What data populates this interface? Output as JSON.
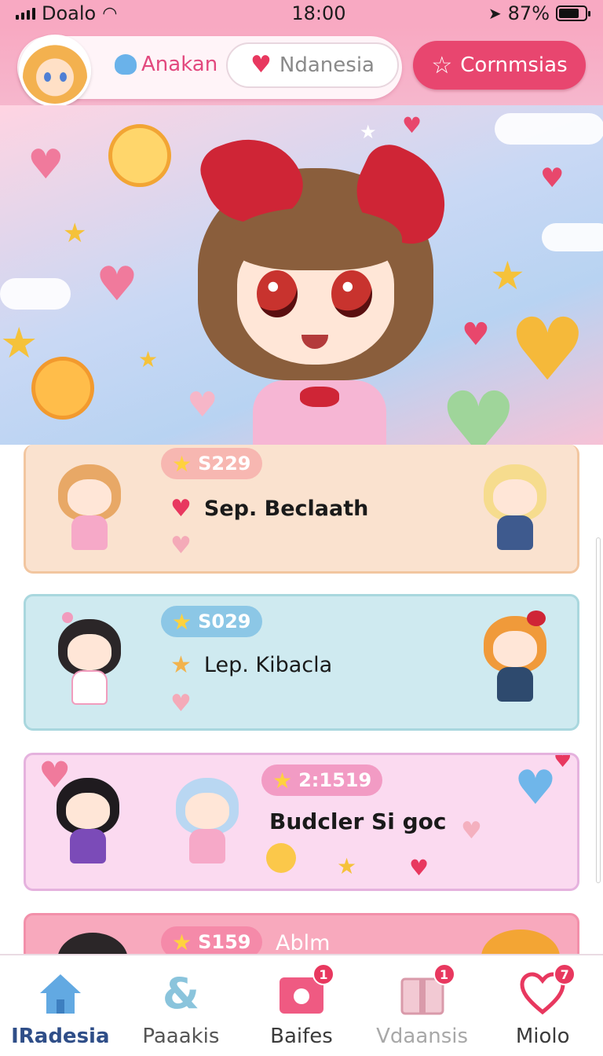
{
  "status_bar": {
    "carrier": "Doalo",
    "time": "18:00",
    "battery": "87%"
  },
  "header": {
    "tabs": [
      {
        "label": "Anakan"
      },
      {
        "label": "Ndanesia"
      },
      {
        "label": "Cornmsias"
      }
    ]
  },
  "cards": [
    {
      "score": "S229",
      "title": "Sep. Beclaath",
      "bg": "#fae2cf",
      "border": "#f2c6a0",
      "chip": "#f7b7b1"
    },
    {
      "score": "S029",
      "title": "Lep. Kibacla",
      "bg": "#cfeaf0",
      "border": "#a9d7de",
      "chip": "#8cc7e6"
    },
    {
      "score": "2:1519",
      "title": "Budcler Si goc",
      "bg": "#fbdaf0",
      "border": "#e5b2de",
      "chip": "#f29bc4"
    },
    {
      "score": "S159",
      "title": "Ablm",
      "bg": "#f8a9bd",
      "border": "#f290aa",
      "chip": "#f58aa9"
    }
  ],
  "nav": {
    "items": [
      {
        "label": "IRadesia",
        "badge": ""
      },
      {
        "label": "Paaakis",
        "badge": ""
      },
      {
        "label": "Baifes",
        "badge": "1"
      },
      {
        "label": "Vdaansis",
        "badge": "1"
      },
      {
        "label": "Miolo",
        "badge": "7"
      }
    ]
  },
  "colors": {
    "accent": "#e8466f",
    "header": "#f8a9c2"
  }
}
